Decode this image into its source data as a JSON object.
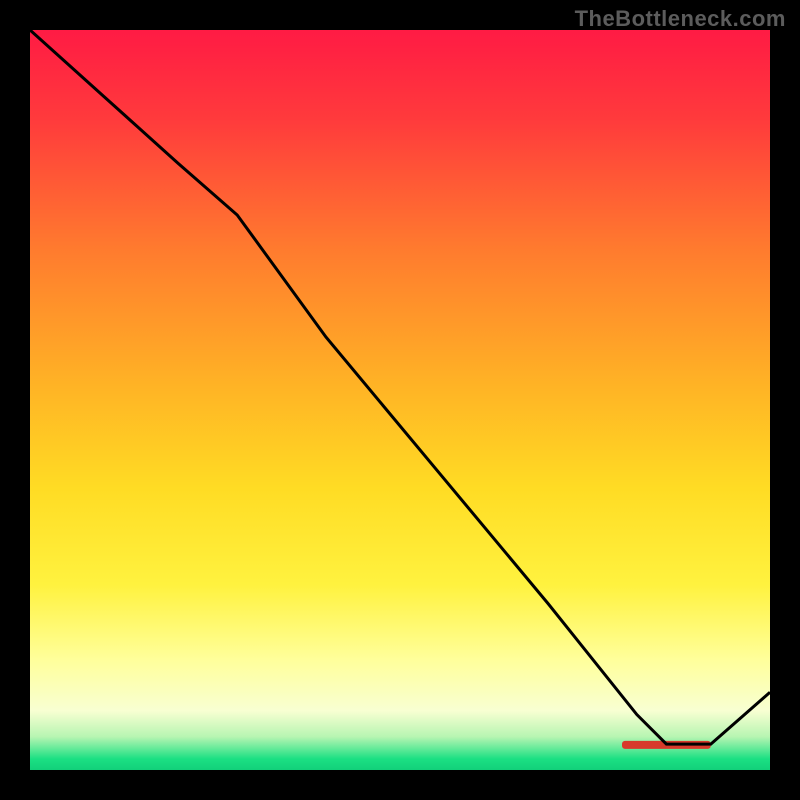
{
  "watermark": "TheBottleneck.com",
  "chart_data": {
    "type": "line",
    "title": "",
    "xlabel": "",
    "ylabel": "",
    "xlim": [
      0,
      100
    ],
    "ylim": [
      0,
      100
    ],
    "grid": false,
    "background_gradient": {
      "stops": [
        {
          "offset": 0.0,
          "color": "#ff1b44"
        },
        {
          "offset": 0.12,
          "color": "#ff3a3c"
        },
        {
          "offset": 0.3,
          "color": "#ff7c2e"
        },
        {
          "offset": 0.48,
          "color": "#ffb325"
        },
        {
          "offset": 0.62,
          "color": "#ffdc24"
        },
        {
          "offset": 0.75,
          "color": "#fff23f"
        },
        {
          "offset": 0.85,
          "color": "#ffff9a"
        },
        {
          "offset": 0.92,
          "color": "#f8ffd2"
        },
        {
          "offset": 0.955,
          "color": "#b7f5b2"
        },
        {
          "offset": 0.985,
          "color": "#1be083"
        },
        {
          "offset": 1.0,
          "color": "#12d07a"
        }
      ]
    },
    "series": [
      {
        "name": "bottleneck-curve",
        "color": "#000000",
        "x": [
          0,
          10,
          20,
          28,
          40,
          55,
          70,
          82,
          86,
          92,
          100
        ],
        "values": [
          100,
          91,
          82,
          75,
          58.5,
          40.5,
          22.5,
          7.5,
          3.5,
          3.5,
          10.5
        ]
      }
    ],
    "annotations": [
      {
        "name": "plateau-marker",
        "type": "rect",
        "x0": 80,
        "x1": 92,
        "y": 3.4,
        "color": "#d83a2b"
      }
    ]
  }
}
